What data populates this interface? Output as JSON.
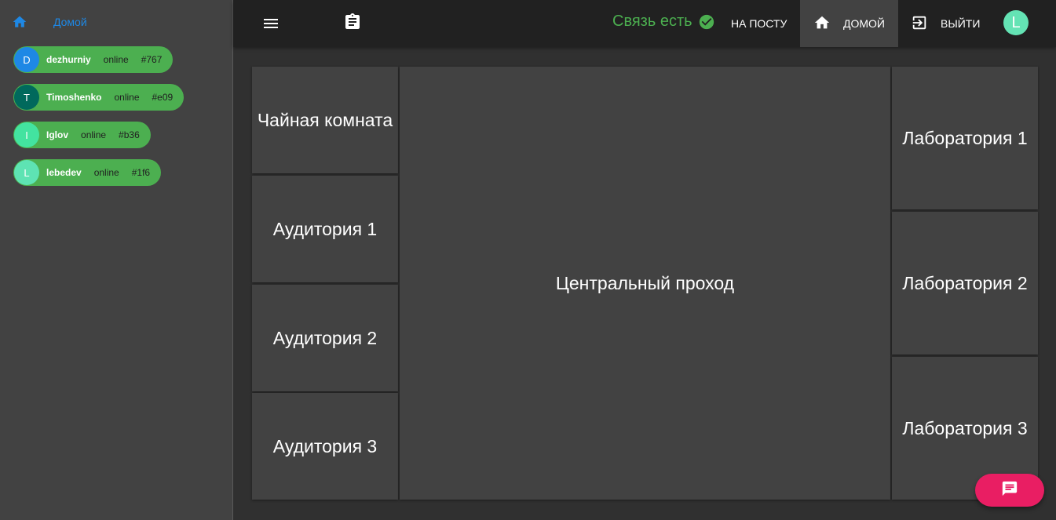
{
  "sidebar": {
    "home_icon": "home-icon",
    "home_label": "Домой",
    "users": [
      {
        "initial": "D",
        "name": "dezhurniy",
        "status": "online",
        "tag": "#767",
        "avatar_color": "#1e88e5"
      },
      {
        "initial": "T",
        "name": "Timoshenko",
        "status": "online",
        "tag": "#e09",
        "avatar_color": "#00695c"
      },
      {
        "initial": "I",
        "name": "Iglov",
        "status": "online",
        "tag": "#b36",
        "avatar_color": "#43e3a0"
      },
      {
        "initial": "L",
        "name": "lebedev",
        "status": "online",
        "tag": "#1f6",
        "avatar_color": "#5ee3b3"
      }
    ]
  },
  "topbar": {
    "menu_icon": "menu-icon",
    "clipboard_icon": "clipboard-icon",
    "connection_text": "Связь есть",
    "connection_color": "#4caf50",
    "post_label": "НА ПОСТУ",
    "home_label": "ДОМОЙ",
    "exit_label": "ВЫЙТИ",
    "avatar_initial": "L"
  },
  "rooms": {
    "tea_room": "Чайная комната",
    "auditorium_1": "Аудитория 1",
    "auditorium_2": "Аудитория 2",
    "auditorium_3": "Аудитория 3",
    "central_passage": "Центральный проход",
    "lab_1": "Лаборатория 1",
    "lab_2": "Лаборатория 2",
    "lab_3": "Лаборатория 3"
  },
  "fab": {
    "icon": "chat-icon",
    "color": "#e91e63"
  }
}
